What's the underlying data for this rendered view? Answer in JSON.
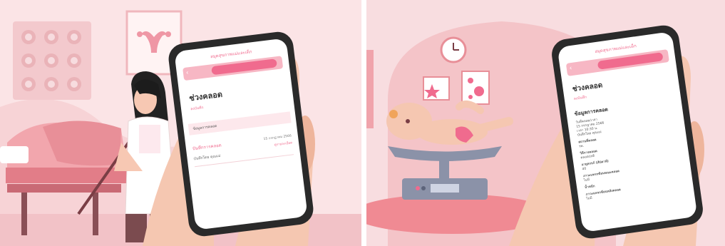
{
  "left": {
    "app_header": "สมุดสุขภาพแม่และเด็ก",
    "section_title": "ช่วงคลอด",
    "section_sub": "ลงบันทึก",
    "card_header": "ข้อมูลการคลอด",
    "record_title": "บันทึกการคลอด",
    "record_date": "15 กรกฎาคม 2566",
    "record_sub": "บันทึกโดย คุณแม่",
    "record_link": "ดูรายละเอียด"
  },
  "right": {
    "app_header": "สมุดสุขภาพแม่และเด็ก",
    "section_title": "ช่วงคลอด",
    "section_sub": "ลงบันทึก",
    "detail_title": "ข้อมูลการคลอด",
    "row1_label": "วันที่คลอด/เวลา",
    "row1_value": "15 กรกฎาคม 2566",
    "row1_value2": "เวลา 10:30 น.",
    "row1_sub": "บันทึกโดย คุณแม่",
    "row2_label": "สถานที่คลอด",
    "row2_value": "รพ.",
    "row3_label": "วิธีการคลอด",
    "row3_value": "คลอดปกติ",
    "row4_label": "อายุครรภ์ (สัปดาห์)",
    "row4_value": "40",
    "row5_label": "ภาวะแทรกซ้อนขณะคลอด",
    "row5_value": "ไม่มี",
    "row6_label": "น้ำหนัก",
    "row7_label": "ภาวะแทรกซ้อนหลังคลอด",
    "row7_value": "ไม่มี"
  },
  "colors": {
    "accent_pink": "#f06b8e",
    "bg_left": "#fbe4e6",
    "bg_right": "#f8dde0",
    "skin": "#f5c7b1"
  }
}
